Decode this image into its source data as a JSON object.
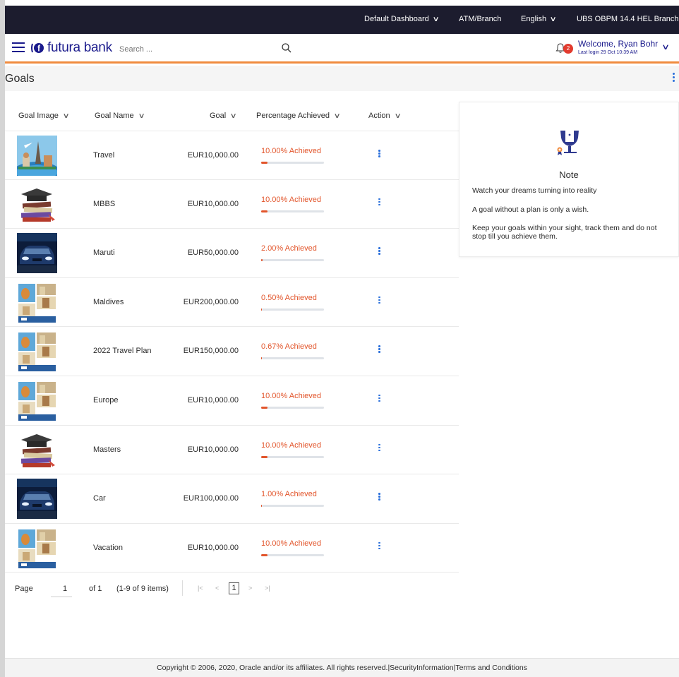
{
  "topbar": {
    "dashboard": "Default Dashboard",
    "atm_branch": "ATM/Branch",
    "language": "English",
    "branch": "UBS OBPM 14.4 HEL Branch"
  },
  "header": {
    "brand": "futura bank",
    "search_placeholder": "Search ...",
    "notification_count": "2",
    "welcome": "Welcome, Ryan Bohr",
    "last_login": "Last login 29 Oct 10:39 AM"
  },
  "page": {
    "title": "Goals"
  },
  "table": {
    "headers": {
      "image": "Goal Image",
      "name": "Goal Name",
      "goal": "Goal",
      "percentage": "Percentage Achieved",
      "action": "Action"
    },
    "rows": [
      {
        "image": "travel-image",
        "name": "Travel",
        "amount": "EUR10,000.00",
        "percent_text": "10.00% Achieved",
        "percent": 10
      },
      {
        "image": "education-image",
        "name": "MBBS",
        "amount": "EUR10,000.00",
        "percent_text": "10.00% Achieved",
        "percent": 10
      },
      {
        "image": "car-image",
        "name": "Maruti",
        "amount": "EUR50,000.00",
        "percent_text": "2.00% Achieved",
        "percent": 2
      },
      {
        "image": "vacation-image",
        "name": "Maldives",
        "amount": "EUR200,000.00",
        "percent_text": "0.50% Achieved",
        "percent": 0.5
      },
      {
        "image": "vacation-image",
        "name": "2022 Travel Plan",
        "amount": "EUR150,000.00",
        "percent_text": "0.67% Achieved",
        "percent": 0.67
      },
      {
        "image": "vacation-image",
        "name": "Europe",
        "amount": "EUR10,000.00",
        "percent_text": "10.00% Achieved",
        "percent": 10
      },
      {
        "image": "education-image",
        "name": "Masters",
        "amount": "EUR10,000.00",
        "percent_text": "10.00% Achieved",
        "percent": 10
      },
      {
        "image": "car-image",
        "name": "Car",
        "amount": "EUR100,000.00",
        "percent_text": "1.00% Achieved",
        "percent": 1
      },
      {
        "image": "vacation-image",
        "name": "Vacation",
        "amount": "EUR10,000.00",
        "percent_text": "10.00% Achieved",
        "percent": 10
      }
    ]
  },
  "pager": {
    "page_label": "Page",
    "page_value": "1",
    "of_label": "of 1",
    "items_label": "(1-9 of 9 items)",
    "current": "1"
  },
  "note": {
    "title": "Note",
    "lines": [
      "Watch your dreams turning into reality",
      "A goal without a plan is only a wish.",
      "Keep your goals within your sight, track them and do not stop till you achieve them."
    ]
  },
  "footer": {
    "text": "Copyright © 2006, 2020, Oracle and/or its affiliates. All rights reserved.|SecurityInformation|Terms and Conditions"
  },
  "colors": {
    "brand": "#1a1a8c",
    "accent": "#f08b3e",
    "percent": "#e2552b",
    "topbar": "#1c1c2e"
  }
}
